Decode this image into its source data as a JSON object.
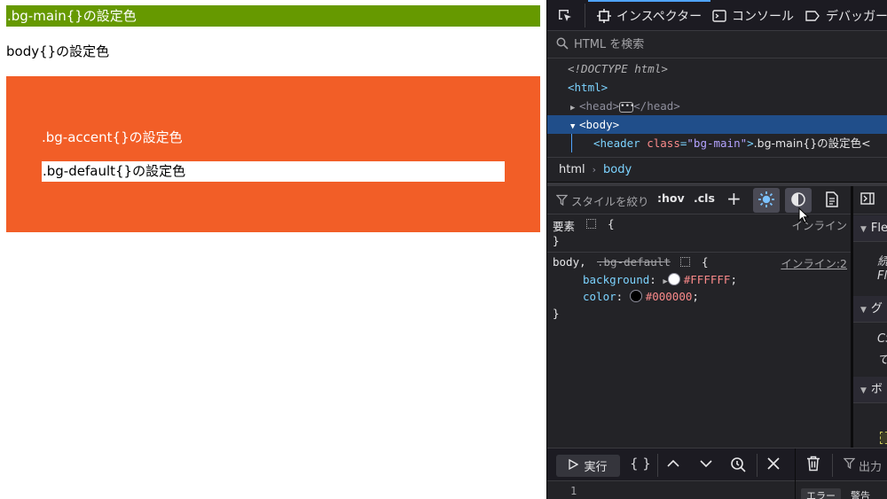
{
  "preview": {
    "bg_main_text": ".bg-main{}の設定色",
    "body_text": "body{}の設定色",
    "bg_accent_text": ".bg-accent{}の設定色",
    "bg_default_text": ".bg-default{}の設定色",
    "colors": {
      "main": "#669900",
      "accent": "#f25e27",
      "default": "#ffffff"
    }
  },
  "devtools": {
    "tabs": {
      "inspector": "インスペクター",
      "console": "コンソール",
      "debugger": "デバッガー"
    },
    "search": {
      "placeholder": "HTML を検索"
    },
    "markup": {
      "doctype": "<!DOCTYPE html>",
      "html_open": "<html>",
      "head_open": "<head>",
      "head_close": "</head>",
      "head_dots": "•••",
      "body_open": "<body>",
      "header_tag_open": "<header",
      "header_attr": "class",
      "header_val": "\"bg-main\"",
      "header_text": ".bg-main{}の設定色<"
    },
    "breadcrumb": {
      "html": "html",
      "body": "body"
    },
    "rules_toolbar": {
      "filter": "スタイルを絞り",
      "hov": ":hov",
      "cls": ".cls",
      "add": "+"
    },
    "rules": {
      "element_selector": "要素",
      "element_open": "{",
      "element_close": "}",
      "element_source": "インライン",
      "body_selector": "body,",
      "body_selector_struck": ".bg-default",
      "body_open": "{",
      "body_close": "}",
      "body_source": "インライン:2",
      "prop_bg": "background",
      "val_bg": "#FFFFFF",
      "prop_color": "color",
      "val_color": "#000000",
      "colon": ":",
      "semicolon": ";"
    },
    "side": {
      "sections": [
        "Fle",
        "グ",
        "ボ"
      ],
      "texts": [
        "続",
        "Fl",
        "CS",
        "て"
      ]
    },
    "console": {
      "run": "実行",
      "braces": "{ }",
      "output": "出力",
      "line_number": "1",
      "badge_error": "エラー",
      "badge_warn": "警告"
    }
  }
}
